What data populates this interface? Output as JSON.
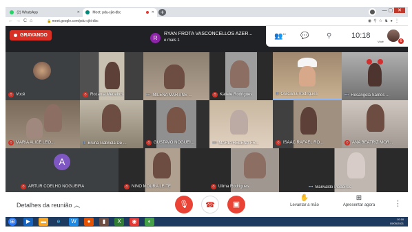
{
  "browser": {
    "tabs": [
      {
        "title": "(2) WhatsApp",
        "color": "#25d366"
      },
      {
        "title": "Meet: pdu-cjkt-dbc",
        "color": "#00897b"
      }
    ],
    "url": "meet.google.com/pdu-cjkt-dbc"
  },
  "meet": {
    "recording_label": "GRAVANDO",
    "presenter": {
      "initial": "R",
      "name": "RYAN FROTA VASCONCELLOS AZER...",
      "more": "e mais 1"
    },
    "people_count": "10",
    "clock": "10:18",
    "self_label": "Você",
    "chat_badge": "6",
    "participants": [
      {
        "name": "Você",
        "status": "muted"
      },
      {
        "name": "Rozania Medeiros",
        "status": "muted"
      },
      {
        "name": "MILENA MARTINS ...",
        "status": "dots"
      },
      {
        "name": "Katiele Rodrigues",
        "status": "muted"
      },
      {
        "name": "Graciana Rodrigues",
        "status": "speaking"
      },
      {
        "name": "Rosangela Santos ...",
        "status": "dots"
      },
      {
        "name": "MARIA ALICE LEO...",
        "status": "muted"
      },
      {
        "name": "Bruna Gabriela De ...",
        "status": "speaking"
      },
      {
        "name": "GUSTAVO NOGUEI...",
        "status": "muted"
      },
      {
        "name": "MARIA HELENA FR...",
        "status": "dots"
      },
      {
        "name": "ISAAC RAFAEL RO...",
        "status": "muted"
      },
      {
        "name": "ANA BEATRIZ MOR...",
        "status": "muted"
      },
      {
        "name": "ARTUR COELHO NOGUEIRA",
        "status": "muted",
        "initial": "A"
      },
      {
        "name": "NINO MOURA LEITE",
        "status": "muted"
      },
      {
        "name": "Ulima Rodrigues",
        "status": "muted"
      },
      {
        "name": "Marivaldo Medeiros",
        "status": "dots"
      }
    ],
    "bottom": {
      "details": "Detalhes da reunião",
      "raise_hand": "Levantar a mão",
      "present": "Apresentar agora"
    }
  },
  "taskbar": {
    "time": "10:18",
    "date": "05/05/2021"
  }
}
